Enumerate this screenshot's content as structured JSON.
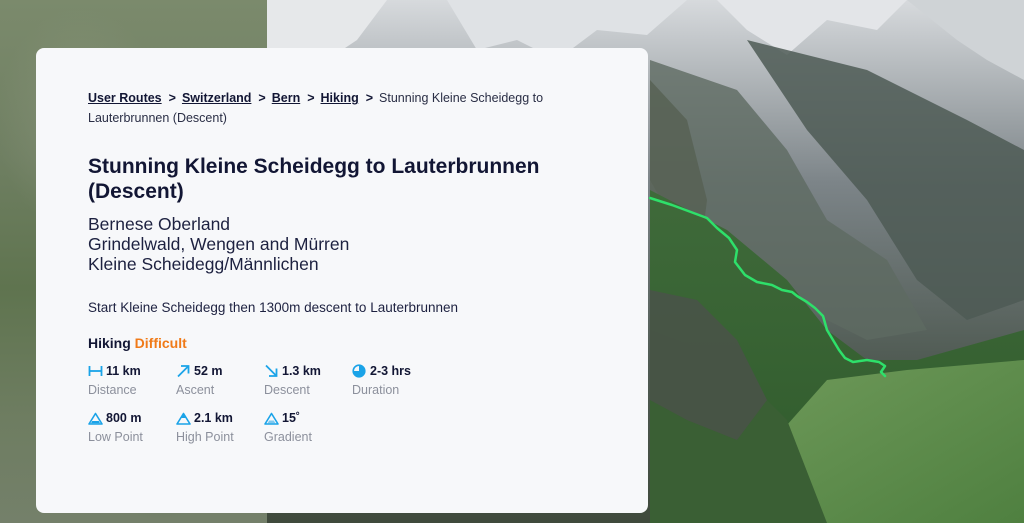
{
  "breadcrumb": {
    "items": [
      "User Routes",
      "Switzerland",
      "Bern",
      "Hiking"
    ],
    "current": "Stunning Kleine Scheidegg to Lauterbrunnen (Descent)",
    "separator": ">"
  },
  "route": {
    "title": "Stunning Kleine Scheidegg to Lauterbrunnen (Descent)",
    "regions": [
      "Bernese Oberland",
      "Grindelwald, Wengen and Mürren",
      "Kleine Scheidegg/Männlichen"
    ],
    "description": "Start Kleine Scheidegg then 1300m descent to Lauterbrunnen",
    "activity": "Hiking",
    "difficulty": "Difficult"
  },
  "stats": [
    {
      "icon": "distance-icon",
      "value": "11 km",
      "label": "Distance"
    },
    {
      "icon": "ascent-icon",
      "value": "52 m",
      "label": "Ascent"
    },
    {
      "icon": "descent-icon",
      "value": "1.3 km",
      "label": "Descent"
    },
    {
      "icon": "duration-icon",
      "value": "2-3 hrs",
      "label": "Duration"
    },
    {
      "icon": "low-point-icon",
      "value": "800 m",
      "label": "Low Point"
    },
    {
      "icon": "high-point-icon",
      "value": "2.1 km",
      "label": "High Point"
    },
    {
      "icon": "gradient-icon",
      "value": "15˚",
      "label": "Gradient"
    }
  ],
  "colors": {
    "accent_icon": "#1aa3e8",
    "difficulty": "#f07a18",
    "route_line": "#2ee06a",
    "text_primary": "#121634",
    "text_muted": "#8c909c",
    "card_bg": "#f7f8fa"
  }
}
